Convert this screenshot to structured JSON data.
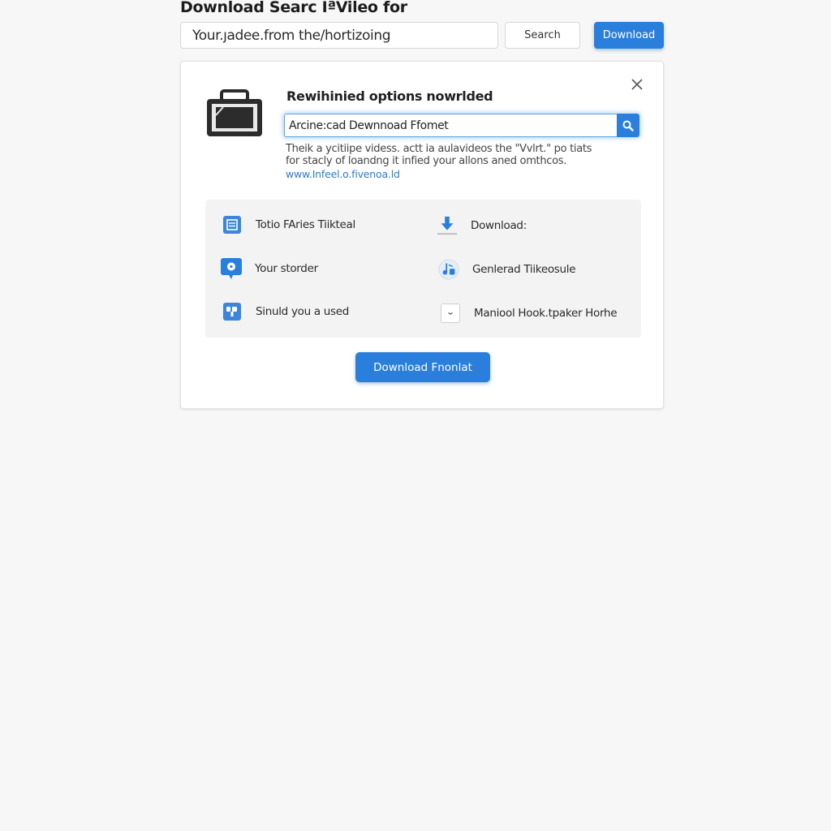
{
  "header": {
    "title": "Download Searc IªVileo for",
    "url_input_value": "Your.ȷadee.from the/hortizoing",
    "search_label": "Search",
    "download_label": "Download"
  },
  "dialog": {
    "heading": "Rewihinied options nowrlded",
    "format_input_value": "Arcine:cad Dewnnoad Ffomet",
    "description": "Theik a ycitiipe videss. actt ia aulavideos the \"Vvlrt.\" po tiats for stacly of loandng it infied your allons aned omthcos.",
    "link": "www.Infeel.o.fivenoa.ld",
    "options": [
      {
        "label": "Totio FAries Tiikteal",
        "icon": "list-icon"
      },
      {
        "label": "Download:",
        "icon": "download-arrow-icon"
      },
      {
        "label": "Your storder",
        "icon": "chat-bubble-icon"
      },
      {
        "label": "Genlerad Tiikeosule",
        "icon": "music-note-icon"
      },
      {
        "label": "Sinuld you a used",
        "icon": "people-icon"
      },
      {
        "label": "Maniool Hook.tpaker Horhe",
        "icon": "dropdown-box-icon"
      }
    ],
    "primary_button": "Download Fnonlat"
  },
  "colors": {
    "accent": "#2b7fdc",
    "link": "#2e7bc9",
    "panel_bg": "#f3f3f3"
  }
}
